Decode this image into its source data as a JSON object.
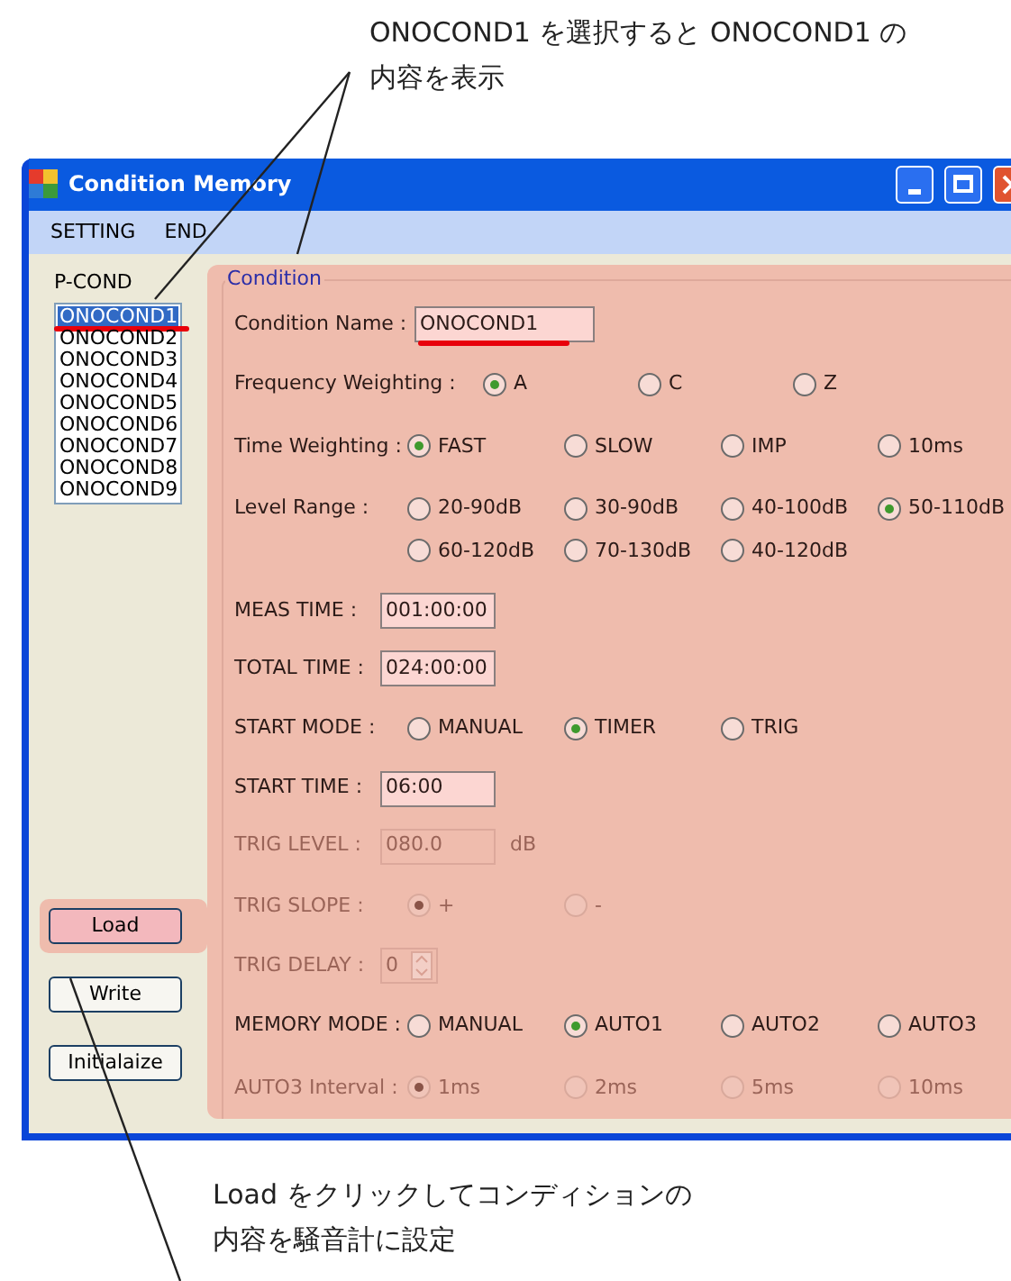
{
  "top_note": {
    "lines": [
      "ONOCOND1 を選択すると ONOCOND1 の",
      "内容を表示"
    ]
  },
  "window": {
    "title": "Condition Memory"
  },
  "menu": [
    "SETTING",
    "END"
  ],
  "p_cond": {
    "label": "P-COND",
    "items": [
      {
        "label": "ONOCOND1",
        "selected": true,
        "marked": true
      },
      {
        "label": "ONOCOND2",
        "selected": false,
        "marked": false
      },
      {
        "label": "ONOCOND3",
        "selected": false,
        "marked": false
      },
      {
        "label": "ONOCOND4",
        "selected": false,
        "marked": false
      },
      {
        "label": "ONOCOND5",
        "selected": false,
        "marked": false
      },
      {
        "label": "ONOCOND6",
        "selected": false,
        "marked": false
      },
      {
        "label": "ONOCOND7",
        "selected": false,
        "marked": false
      },
      {
        "label": "ONOCOND8",
        "selected": false,
        "marked": false
      },
      {
        "label": "ONOCOND9",
        "selected": false,
        "marked": false
      }
    ]
  },
  "buttons": [
    {
      "label": "Load",
      "highlighted": true
    },
    {
      "label": "Write",
      "highlighted": false
    },
    {
      "label": "Initialaize",
      "highlighted": false
    }
  ],
  "condition": {
    "title": "Condition",
    "rows": [
      {
        "kind": "field",
        "label": "Condition Name :",
        "value": "ONOCOND1",
        "disabled": false,
        "marked": true
      },
      {
        "kind": "radio",
        "label": "Frequency Weighting :",
        "disabled": false,
        "options": [
          {
            "label": "A",
            "selected": true
          },
          {
            "label": "C",
            "selected": false
          },
          {
            "label": "Z",
            "selected": false
          }
        ]
      },
      {
        "kind": "radio",
        "label": "Time Weighting :",
        "disabled": false,
        "options": [
          {
            "label": "FAST",
            "selected": true
          },
          {
            "label": "SLOW",
            "selected": false
          },
          {
            "label": "IMP",
            "selected": false
          },
          {
            "label": "10ms",
            "selected": false
          }
        ]
      },
      {
        "kind": "radio",
        "label": "Level Range :",
        "disabled": false,
        "options": [
          {
            "label": "20-90dB",
            "selected": false
          },
          {
            "label": "30-90dB",
            "selected": false
          },
          {
            "label": "40-100dB",
            "selected": false
          },
          {
            "label": "50-110dB",
            "selected": true
          },
          {
            "label": "60-120dB",
            "selected": false
          },
          {
            "label": "70-130dB",
            "selected": false
          },
          {
            "label": "40-120dB",
            "selected": false
          }
        ]
      },
      {
        "kind": "field",
        "label": "MEAS TIME :",
        "value": "001:00:00",
        "disabled": false,
        "marked": false
      },
      {
        "kind": "field",
        "label": "TOTAL TIME :",
        "value": "024:00:00",
        "disabled": false,
        "marked": false
      },
      {
        "kind": "radio",
        "label": "START MODE :",
        "disabled": false,
        "options": [
          {
            "label": "MANUAL",
            "selected": false
          },
          {
            "label": "TIMER",
            "selected": true
          },
          {
            "label": "TRIG",
            "selected": false
          }
        ]
      },
      {
        "kind": "field",
        "label": "START TIME :",
        "value": "06:00",
        "disabled": false,
        "marked": false
      },
      {
        "kind": "field",
        "label": "TRIG LEVEL :",
        "value": "080.0",
        "unit": "dB",
        "disabled": true,
        "marked": false
      },
      {
        "kind": "radio",
        "label": "TRIG SLOPE :",
        "disabled": true,
        "options": [
          {
            "label": "+",
            "selected": true
          },
          {
            "label": "-",
            "selected": false
          }
        ]
      },
      {
        "kind": "spin",
        "label": "TRIG DELAY :",
        "value": "0",
        "disabled": true
      },
      {
        "kind": "radio",
        "label": "MEMORY MODE :",
        "disabled": false,
        "options": [
          {
            "label": "MANUAL",
            "selected": false
          },
          {
            "label": "AUTO1",
            "selected": true
          },
          {
            "label": "AUTO2",
            "selected": false
          },
          {
            "label": "AUTO3",
            "selected": false
          }
        ]
      },
      {
        "kind": "radio",
        "label": "AUTO3 Interval :",
        "disabled": true,
        "options": [
          {
            "label": "1ms",
            "selected": true
          },
          {
            "label": "2ms",
            "selected": false
          },
          {
            "label": "5ms",
            "selected": false
          },
          {
            "label": "10ms",
            "selected": false
          }
        ]
      }
    ]
  },
  "bottom_note": {
    "lines": [
      "Load をクリックしてコンディションの",
      "内容を騒音計に設定"
    ]
  }
}
